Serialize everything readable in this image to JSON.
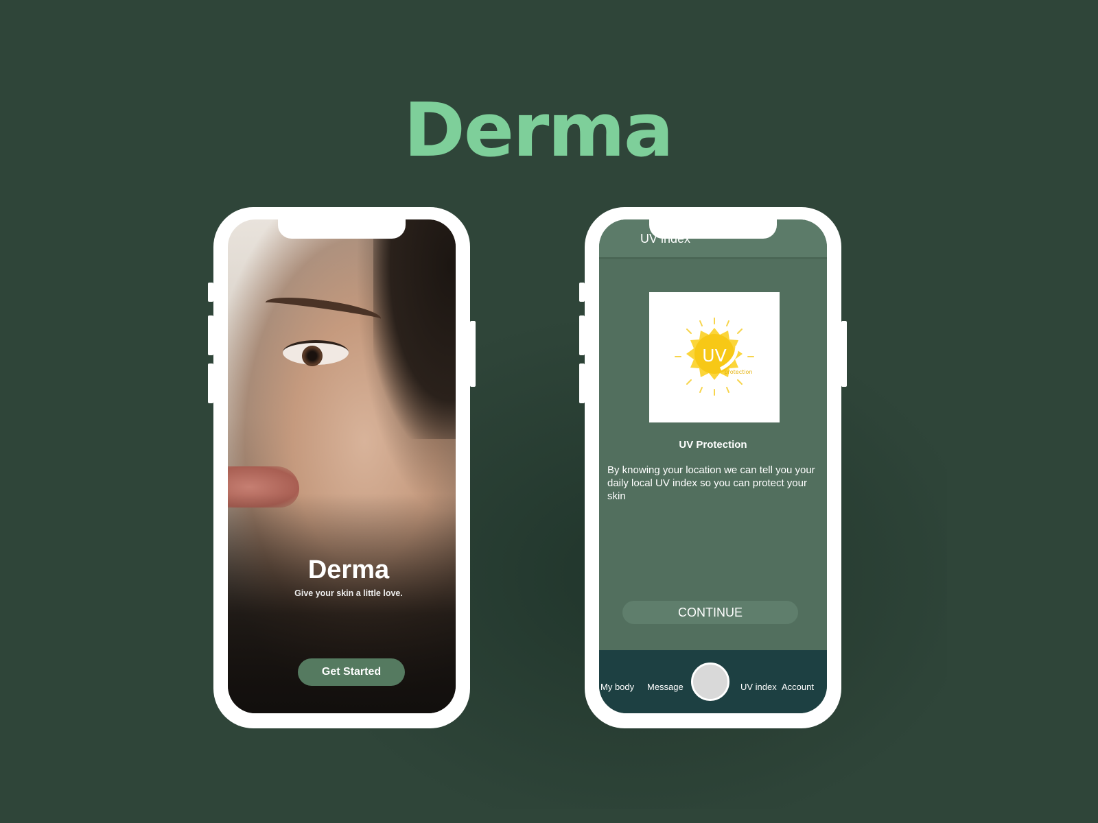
{
  "brand": {
    "title": "Derma",
    "title_color": "#7ecf9a"
  },
  "splash": {
    "title": "Derma",
    "subtitle": "Give your skin a little love.",
    "cta_label": "Get Started",
    "cta_color": "#557a60"
  },
  "uv": {
    "header_title": "UV index",
    "image_text": "UV",
    "image_subtext": "protection",
    "card_title": "UV Protection",
    "description": "By knowing your location we can tell you your daily local UV index so you can protect your skin",
    "continue_label": "CONTINUE"
  },
  "tabbar": {
    "items": [
      {
        "label": "My body"
      },
      {
        "label": "Message"
      },
      {
        "label": "UV index"
      },
      {
        "label": "Account"
      }
    ],
    "center_icon": "camera-button-icon",
    "background": "#1d4042"
  },
  "colors": {
    "background": "#2f4539",
    "uv_screen": "#526f5e",
    "sun_yellow": "#f7c816"
  }
}
